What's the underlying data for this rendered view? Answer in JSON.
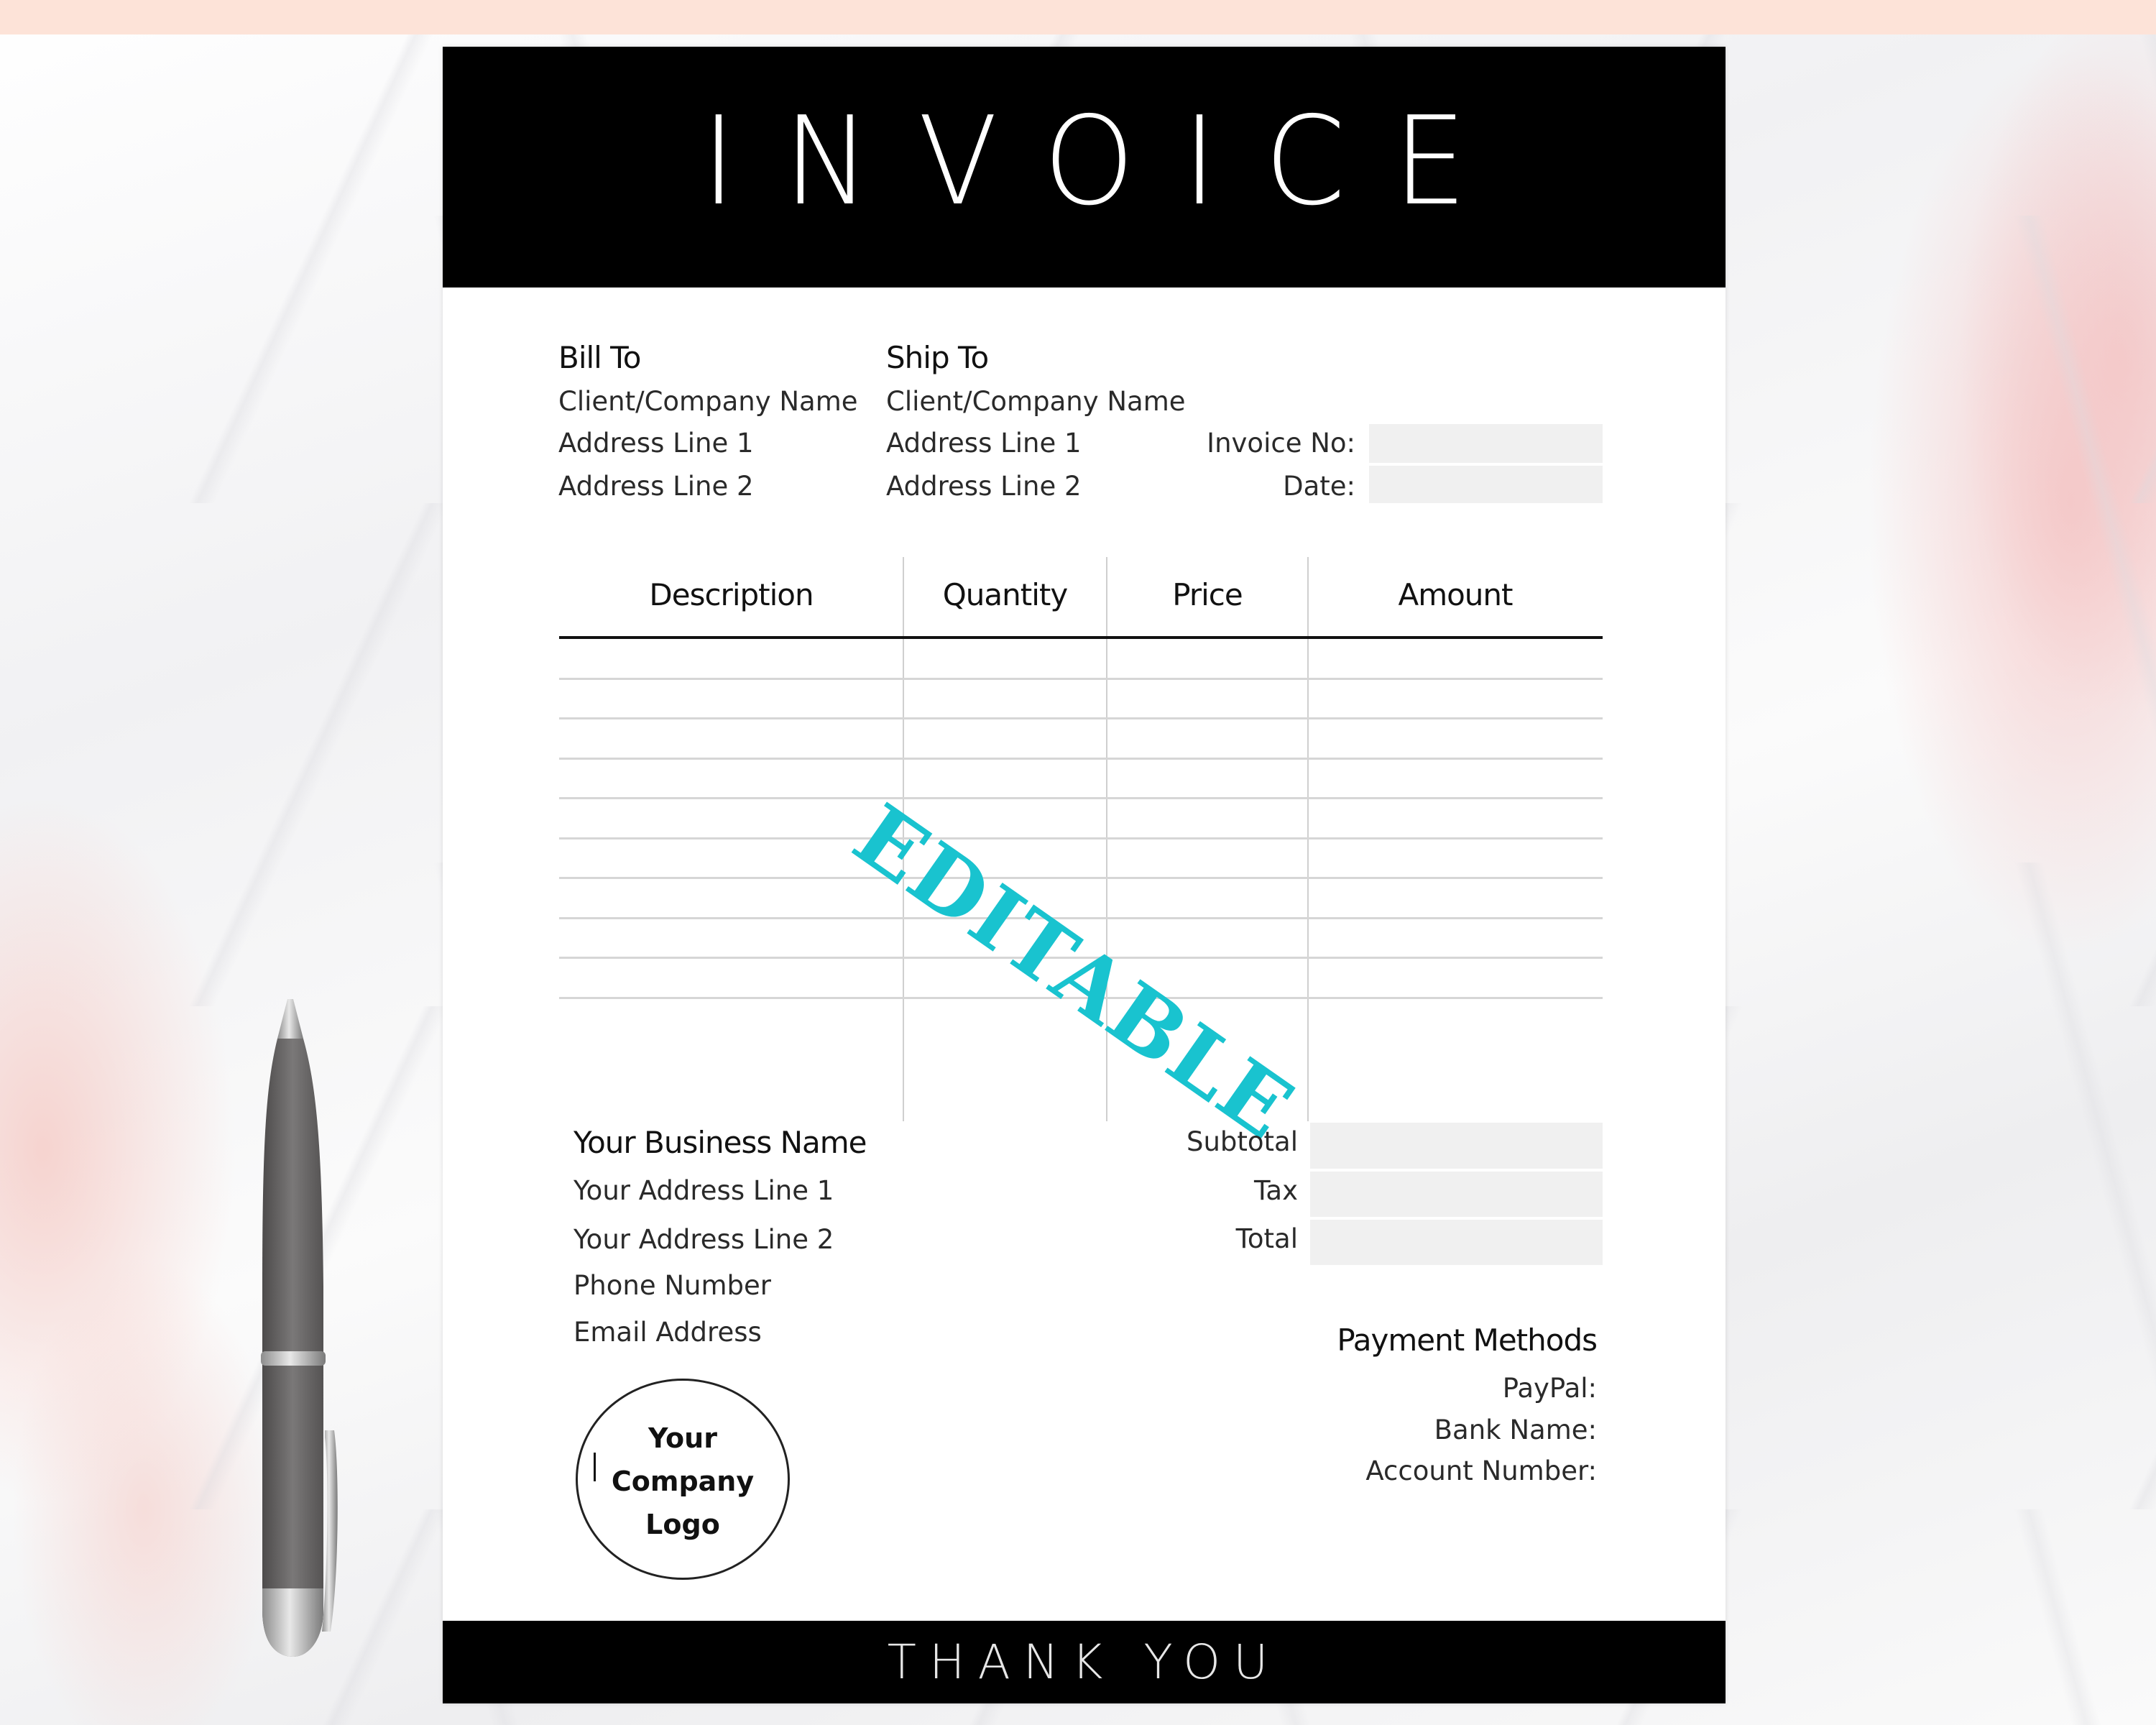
{
  "invoice": {
    "title": "INVOICE",
    "bill_to": {
      "heading": "Bill To",
      "lines": [
        "Client/Company Name",
        "Address Line 1",
        "Address Line 2"
      ]
    },
    "ship_to": {
      "heading": "Ship To",
      "lines": [
        "Client/Company Name",
        "Address Line 1",
        "Address Line 2"
      ]
    },
    "meta": {
      "invoice_no_label": "Invoice No:",
      "invoice_no_value": "",
      "date_label": "Date:",
      "date_value": ""
    },
    "table": {
      "columns": [
        "Description",
        "Quantity",
        "Price",
        "Amount"
      ],
      "rows": [
        [
          "",
          "",
          "",
          ""
        ],
        [
          "",
          "",
          "",
          ""
        ],
        [
          "",
          "",
          "",
          ""
        ],
        [
          "",
          "",
          "",
          ""
        ],
        [
          "",
          "",
          "",
          ""
        ],
        [
          "",
          "",
          "",
          ""
        ],
        [
          "",
          "",
          "",
          ""
        ],
        [
          "",
          "",
          "",
          ""
        ],
        [
          "",
          "",
          "",
          ""
        ]
      ]
    },
    "watermark": "EDITABLE",
    "business": {
      "name": "Your Business Name",
      "lines": [
        "Your Address Line 1",
        "Your Address Line 2",
        "Phone Number",
        "Email Address"
      ]
    },
    "totals": {
      "subtotal_label": "Subtotal",
      "subtotal_value": "",
      "tax_label": "Tax",
      "tax_value": "",
      "total_label": "Total",
      "total_value": ""
    },
    "payment": {
      "heading": "Payment Methods",
      "lines": [
        "PayPal:",
        "Bank Name:",
        "Account Number:"
      ]
    },
    "logo": {
      "lines": [
        "Your",
        "Company",
        "Logo"
      ]
    },
    "footer": "THANK YOU"
  },
  "colors": {
    "band": "#000000",
    "watermark": "#19c3cf",
    "field_fill": "#f0f0f0",
    "accent_pink": "#f4c4c4"
  },
  "decor": {
    "pen_icon": "ballpoint-pen"
  }
}
